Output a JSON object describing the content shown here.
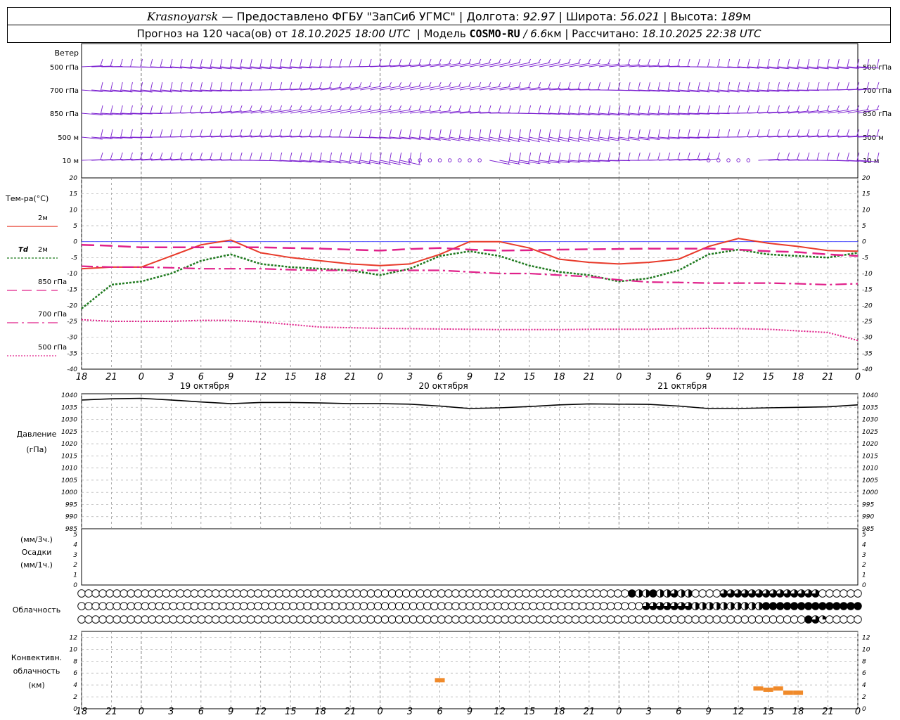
{
  "header": {
    "station": "Krasnoyarsk",
    "provider": " — Предоставлено ФГБУ \"ЗапСиб УГМС\" | Долгота: ",
    "lon": "92.97",
    "lat_label": " | Широта: ",
    "lat": "56.021",
    "alt_label": " | Высота: ",
    "alt": "189",
    "alt_unit": "м",
    "forecast_label": "Прогноз на 120 часа(ов) от ",
    "forecast_time": "18.10.2025 18:00 UTC",
    "model_label": "  | Модель ",
    "model": "COSMO-RU",
    "model_res": " / 6.6",
    "model_res_unit": "км",
    "calc_label": " | Рассчитано: ",
    "calc_time": "18.10.2025 22:38 UTC"
  },
  "panels": {
    "wind": {
      "title": "Ветер",
      "levels": [
        "500 гПа",
        "700 гПа",
        "850 гПа",
        "500 м",
        "10 м"
      ],
      "color": "#7a1fd0"
    },
    "temperature": {
      "title": "Тем-ра(°С)",
      "legend": [
        {
          "label": "2м",
          "italic": "",
          "color": "#e83a2a",
          "style": "solid"
        },
        {
          "label": "2м",
          "italic": "Td",
          "color": "#1f7a1f",
          "style": "dotted"
        },
        {
          "label": "850 гПа",
          "italic": "",
          "color": "#e0208a",
          "style": "dash"
        },
        {
          "label": "700 гПа",
          "italic": "",
          "color": "#e0208a",
          "style": "dashdot"
        },
        {
          "label": "500 гПа",
          "italic": "",
          "color": "#e0208a",
          "style": "dot"
        }
      ],
      "ticks": [
        "20",
        "15",
        "10",
        "5",
        "0",
        "-5",
        "-10",
        "-15",
        "-20",
        "-25",
        "-30",
        "-35",
        "-40"
      ]
    },
    "pressure": {
      "title": "Давление",
      "unit": "(гПа)",
      "ticks": [
        "1040",
        "1035",
        "1030",
        "1025",
        "1020",
        "1015",
        "1010",
        "1005",
        "1000",
        "995",
        "990",
        "985"
      ]
    },
    "precip": {
      "unit_top": "(мм/3ч.)",
      "title": "Осадки",
      "unit_bottom": "(мм/1ч.)",
      "ticks": [
        "5",
        "4",
        "3",
        "2",
        "1",
        "0"
      ]
    },
    "clouds": {
      "title": "Облачность"
    },
    "convective": {
      "title_1": "Конвективн.",
      "title_2": "облачность",
      "title_3": "(км)",
      "ticks": [
        "12",
        "10",
        "8",
        "6",
        "4",
        "2",
        "0"
      ],
      "color": "#f08a2a"
    }
  },
  "time_axis": {
    "hour_labels": [
      "18",
      "21",
      "0",
      "3",
      "6",
      "9",
      "12",
      "15",
      "18",
      "21",
      "0",
      "3",
      "6",
      "9",
      "12",
      "15",
      "18",
      "21",
      "0",
      "3",
      "6",
      "9",
      "12",
      "15",
      "18",
      "21",
      "0"
    ],
    "day_labels": [
      "19 октября",
      "20 октября",
      "21 октября"
    ]
  },
  "chart_data": {
    "type": "line",
    "x_hours_from_start": [
      0,
      3,
      6,
      9,
      12,
      15,
      18,
      21,
      24,
      27,
      30,
      33,
      36,
      39,
      42,
      45,
      48,
      51,
      54,
      57,
      60,
      63,
      66,
      69,
      72,
      75,
      78
    ],
    "series": [
      {
        "name": "2м",
        "values": [
          -8.5,
          -8,
          -8,
          -4.5,
          -1,
          0.5,
          -3.5,
          -5,
          -6,
          -7,
          -7.5,
          -7,
          -4,
          0,
          0,
          -2,
          -5.5,
          -6.5,
          -7,
          -6.5,
          -5.5,
          -1.5,
          1,
          -0.5,
          -1.5,
          -2.8,
          -3
        ]
      },
      {
        "name": "Td 2м",
        "values": [
          -21,
          -13.5,
          -12.5,
          -10,
          -6,
          -4,
          -7,
          -8,
          -8.5,
          -9,
          -10.5,
          -8.5,
          -4.5,
          -3,
          -4.5,
          -7.5,
          -9.5,
          -10.5,
          -12.5,
          -11.5,
          -9,
          -4,
          -2.5,
          -4,
          -4.5,
          -5,
          -3.5
        ]
      },
      {
        "name": "850 гПа",
        "values": [
          -1,
          -1.3,
          -1.8,
          -1.8,
          -1.8,
          -1.8,
          -1.8,
          -2,
          -2.2,
          -2.5,
          -2.8,
          -2.3,
          -2,
          -2.5,
          -2.8,
          -2.7,
          -2.5,
          -2.4,
          -2.3,
          -2.2,
          -2.2,
          -2.2,
          -2.5,
          -3,
          -3.3,
          -4,
          -4.5
        ]
      },
      {
        "name": "700 гПа",
        "values": [
          -7.7,
          -8,
          -8,
          -8.2,
          -8.5,
          -8.5,
          -8.5,
          -8.8,
          -9,
          -9,
          -9,
          -9,
          -9,
          -9.5,
          -10,
          -10,
          -10.5,
          -11,
          -12,
          -12.7,
          -12.8,
          -13,
          -13,
          -13,
          -13.2,
          -13.5,
          -13.2
        ]
      },
      {
        "name": "500 гПа",
        "values": [
          -24.5,
          -25,
          -25,
          -25,
          -24.7,
          -24.7,
          -25.2,
          -26,
          -26.8,
          -27,
          -27.2,
          -27.3,
          -27.4,
          -27.5,
          -27.6,
          -27.6,
          -27.6,
          -27.5,
          -27.5,
          -27.5,
          -27.3,
          -27.2,
          -27.3,
          -27.5,
          -28,
          -28.5,
          -31
        ]
      },
      {
        "name": "Давление",
        "values": [
          1038,
          1038.5,
          1038.7,
          1038,
          1037.2,
          1036.5,
          1037,
          1037,
          1036.8,
          1036.5,
          1036.5,
          1036.3,
          1035.5,
          1034.5,
          1034.8,
          1035.3,
          1036,
          1036.4,
          1036.3,
          1036.2,
          1035.5,
          1034.5,
          1034.5,
          1034.8,
          1035,
          1035.2,
          1036
        ]
      }
    ],
    "temp_ylim": [
      -40,
      20
    ],
    "pressure_ylim": [
      985,
      1040
    ],
    "precip_ylim": [
      0,
      5
    ],
    "convective_ylim": [
      0,
      13
    ],
    "convective_bars": [
      {
        "hour": 36,
        "value": 4.8
      },
      {
        "hour": 68,
        "value": 3.4
      },
      {
        "hour": 69,
        "value": 3.2
      },
      {
        "hour": 70,
        "value": 3.4
      },
      {
        "hour": 71,
        "value": 2.7
      },
      {
        "hour": 72,
        "value": 2.7
      }
    ],
    "clouds": {
      "upper": [
        0,
        0,
        0,
        0,
        0,
        0,
        0,
        0,
        0,
        0,
        0,
        0,
        0,
        0,
        0,
        0,
        0,
        0,
        0,
        0,
        0,
        0,
        0,
        0,
        0,
        0,
        0,
        0,
        0,
        0,
        0,
        0,
        0,
        0,
        0,
        0,
        0,
        0,
        0,
        0,
        0,
        0,
        0,
        0,
        0,
        0,
        0,
        0,
        0,
        0,
        0,
        0,
        0,
        0,
        0,
        0,
        0,
        0,
        0,
        0,
        0,
        0,
        0,
        0,
        0,
        0,
        0,
        0,
        0,
        0,
        0,
        0,
        0,
        0,
        0,
        0,
        0,
        0,
        0,
        0,
        0,
        0,
        0,
        0,
        0,
        0,
        0,
        0,
        0,
        0,
        0,
        0,
        0,
        0,
        0,
        0,
        0,
        0,
        0,
        0,
        0,
        0,
        0,
        0,
        0,
        0,
        0,
        0,
        0,
        0,
        0
      ],
      "middle": [
        0,
        0,
        0,
        0,
        0,
        0,
        0,
        0,
        0,
        0,
        0,
        0,
        0,
        0,
        0,
        0,
        0,
        0,
        0,
        0,
        0,
        0,
        0,
        0,
        0,
        0,
        0,
        0,
        0,
        0,
        0,
        0,
        0,
        0,
        0,
        0,
        0,
        0,
        0,
        0,
        0,
        0,
        0,
        0,
        0,
        0,
        0,
        0,
        0,
        0,
        0,
        0,
        0,
        0,
        0,
        0,
        0,
        0,
        0,
        0,
        0,
        0,
        0,
        0,
        0,
        0,
        0,
        0,
        0,
        0,
        0,
        0,
        0,
        0,
        0,
        0,
        0,
        0,
        0,
        0,
        0,
        0,
        0,
        0,
        0,
        0,
        0,
        0,
        0,
        0,
        0,
        0,
        0,
        0,
        0,
        0,
        0,
        0,
        0,
        0,
        0,
        0,
        0,
        0,
        0,
        0,
        0,
        0,
        0,
        0,
        0
      ],
      "lower": [
        0,
        0,
        0,
        0,
        0,
        0,
        0,
        0,
        0,
        0,
        0,
        0,
        0,
        0,
        0,
        0,
        0,
        0,
        0,
        0,
        0,
        0,
        0,
        0,
        0,
        0,
        0,
        0,
        0,
        0,
        0,
        0,
        0,
        0,
        0,
        0,
        0,
        0,
        0,
        0,
        0,
        0,
        0,
        0,
        0,
        0,
        0,
        0,
        0,
        0,
        0,
        0,
        0,
        0,
        0,
        0,
        0,
        0,
        0,
        0,
        0,
        0,
        0,
        0,
        0,
        0,
        0,
        0,
        0,
        0,
        0,
        0,
        0,
        0,
        0,
        0,
        0,
        0,
        0,
        0,
        0,
        0,
        0,
        0,
        0,
        0,
        0,
        0,
        0,
        0,
        0,
        0,
        0,
        0,
        0,
        0,
        0,
        0,
        0,
        0,
        0,
        0,
        0,
        0,
        0,
        0,
        0,
        0,
        0,
        0,
        0
      ]
    }
  }
}
